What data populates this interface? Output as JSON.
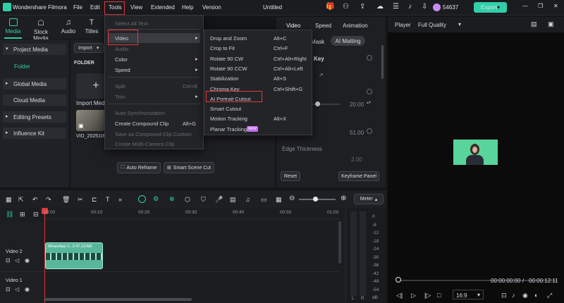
{
  "app": {
    "name": "Wondershare Filmora",
    "title": "Untitled",
    "credits": "54637",
    "export_label": "Export"
  },
  "menubar": [
    "File",
    "Edit",
    "Tools",
    "View",
    "Extended",
    "Help",
    "Version"
  ],
  "toolbar": [
    {
      "label": "Media",
      "icon": "media-icon"
    },
    {
      "label": "Stock Media",
      "icon": "stock-media-icon"
    },
    {
      "label": "Audio",
      "icon": "audio-icon"
    },
    {
      "label": "Titles",
      "icon": "titles-icon"
    }
  ],
  "sidebar": [
    {
      "label": "Project Media"
    },
    {
      "label": "Folder"
    },
    {
      "label": "Global Media"
    },
    {
      "label": "Cloud Media"
    },
    {
      "label": "Editing Presets"
    },
    {
      "label": "Influence Kit"
    }
  ],
  "media": {
    "import_label": "Import",
    "folder_label": "FOLDER",
    "import_media": "Import Media",
    "clip_name": "VID_2025100"
  },
  "tools_menu": [
    {
      "label": "Select All Text",
      "disabled": true
    },
    {
      "label": "Video",
      "submenu": true
    },
    {
      "label": "Audio",
      "disabled": true
    },
    {
      "label": "Color",
      "submenu": true
    },
    {
      "label": "Speed",
      "submenu": true
    },
    {
      "label": "Split",
      "shortcut": "Ctrl+B",
      "disabled": true
    },
    {
      "label": "Trim",
      "disabled": true,
      "submenu": true
    },
    {
      "label": "Auto Synchronization",
      "disabled": true
    },
    {
      "label": "Create Compound Clip",
      "shortcut": "Alt+G"
    },
    {
      "label": "Save as Compound Clip Custom",
      "disabled": true
    },
    {
      "label": "Create Multi-Camera Clip",
      "disabled": true
    }
  ],
  "video_submenu": [
    {
      "label": "Drop and Zoom",
      "shortcut": "Alt+C"
    },
    {
      "label": "Crop to Fit",
      "shortcut": "Ctrl+F"
    },
    {
      "label": "Rotate 90 CW",
      "shortcut": "Ctrl+Alt+Right"
    },
    {
      "label": "Rotate 90 CCW",
      "shortcut": "Ctrl+Alt+Left"
    },
    {
      "label": "Stabilization",
      "shortcut": "Alt+S"
    },
    {
      "label": "Chroma Key",
      "shortcut": "Ctrl+Shift+G"
    },
    {
      "label": "AI Portrait Cutout",
      "shortcut": ""
    },
    {
      "label": "Smart Cutout",
      "shortcut": ""
    },
    {
      "label": "Motion Tracking",
      "shortcut": "Alt+X"
    },
    {
      "label": "Planar Tracking",
      "shortcut": "",
      "badge": "NEW"
    }
  ],
  "media_buttons": {
    "auto_reframe": "Auto Reframe",
    "smart_scene_cut": "Smart Scene Cut"
  },
  "props": {
    "tabs": [
      "Video",
      "Speed",
      "Animation"
    ],
    "subtabs": [
      "Mask",
      "AI Matting"
    ],
    "key_label": "Key",
    "value1": "20.00",
    "value2": "51.00",
    "edge_label": "Edge Thickness",
    "value3": "2.00",
    "reset": "Reset",
    "keyframe": "Keyframe Panel"
  },
  "player": {
    "label": "Player",
    "quality": "Full Quality",
    "current_time": "00:00:00:00",
    "total_time": "00:00:12:11",
    "ratio": "16:9"
  },
  "timeline": {
    "meter_label": "Meter",
    "ticks": [
      "00:00",
      "00:10",
      "00:20",
      "00:30",
      "00:40",
      "00:50",
      "01:00"
    ],
    "track2": "Video 2",
    "track1": "Video 1",
    "clip_label": "WhatsApp V...2.47.13 AM"
  },
  "meter": {
    "db": [
      "0",
      "-6",
      "-12",
      "-18",
      "-24",
      "-30",
      "-36",
      "-42",
      "-48",
      "-54",
      "dB"
    ],
    "lr": [
      "L",
      "R"
    ]
  },
  "colors": {
    "accent": "#2fd0a8",
    "highlight": "#e23b3b",
    "menu_hover": "#3a3c42"
  }
}
